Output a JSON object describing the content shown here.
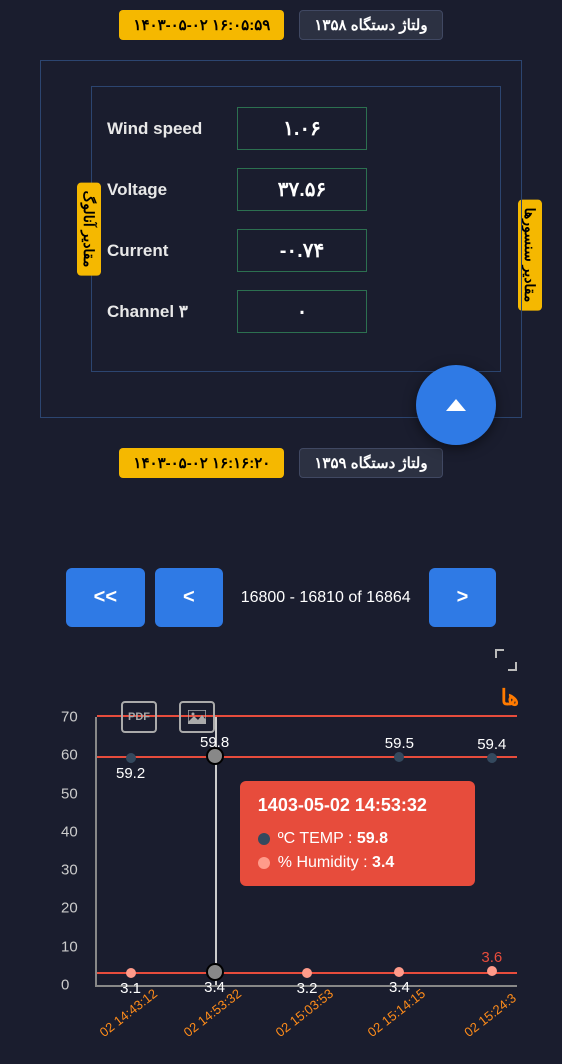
{
  "top_badge_time": "۱۴۰۳-۰۵-۰۲ ۱۶:۰۵:۵۹",
  "top_badge_device": "ولتاژ دستگاه ۱۳۵۸",
  "side_right_far": "مقادیر سنسورها",
  "side_left": "مقادیر آنالوگ",
  "fields": [
    {
      "label": "Wind speed",
      "value": "۱.۰۶"
    },
    {
      "label": "Voltage",
      "value": "۳۷.۵۶"
    },
    {
      "label": "Current",
      "value": "-۰.۷۴"
    },
    {
      "label": "Channel ۳",
      "value": "۰"
    }
  ],
  "bottom_badge_time": "۱۴۰۳-۰۵-۰۲ ۱۶:۱۶:۲۰",
  "bottom_badge_device": "ولتاژ دستگاه ۱۳۵۹",
  "pager_text": "16800 - 16810 of 16864",
  "pdf": "PDF",
  "ha": "ها",
  "chart_data": {
    "type": "line",
    "ylim": [
      0,
      70
    ],
    "yticks": [
      0,
      10,
      20,
      30,
      40,
      50,
      60,
      70
    ],
    "x_labels": [
      "02 14:43:12",
      "02 14:53:32",
      "02 15:03:53",
      "02 15:14:15",
      "02 15:24:3"
    ],
    "series": [
      {
        "name": "ºC TEMP",
        "color": "#34495e",
        "values": [
          59.2,
          59.8,
          null,
          59.5,
          59.4
        ]
      },
      {
        "name": "% Humidity",
        "color": "#ff9b8a",
        "values": [
          3.1,
          3.4,
          3.2,
          3.4,
          3.6
        ]
      }
    ],
    "tooltip": {
      "title": "1403-05-02 14:53:32",
      "rows": [
        {
          "dot": "blue",
          "label": "ºC TEMP :",
          "val": "59.8"
        },
        {
          "dot": "red",
          "label": "% Humidity :",
          "val": "3.4"
        }
      ],
      "x_index": 1
    }
  }
}
